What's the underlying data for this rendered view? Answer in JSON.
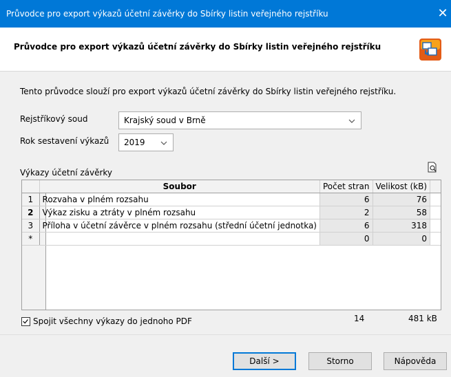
{
  "window": {
    "title": "Průvodce pro export výkazů účetní závěrky do Sbírky listin veřejného rejstříku",
    "close_glyph": "✕"
  },
  "header": {
    "title": "Průvodce pro export výkazů účetní závěrky do Sbírky listin veřejného rejstříku",
    "logo_icon": "export-wizard-icon",
    "logo_colors": [
      "#f7a21b",
      "#e35b16",
      "#2b6cb0"
    ]
  },
  "intro": "Tento průvodce slouží pro export výkazů účetní závěrky do Sbírky listin veřejného rejstříku.",
  "form": {
    "court_label": "Rejstříkový soud",
    "court_value": "Krajský soud v Brně",
    "year_label": "Rok sestavení výkazů",
    "year_value": "2019"
  },
  "reports": {
    "label": "Výkazy účetní závěrky",
    "preview_icon": "print-preview-icon",
    "columns": [
      "Soubor",
      "Počet stran",
      "Velikost (kB)"
    ],
    "rows": [
      {
        "num": "1",
        "file": "Rozvaha v plném rozsahu",
        "pages": "6",
        "size": "76"
      },
      {
        "num": "2",
        "file": "Výkaz zisku a ztráty v plném rozsahu",
        "pages": "2",
        "size": "58"
      },
      {
        "num": "3",
        "file": "Příloha v účetní závěrce v plném rozsahu (střední účetní jednotka)",
        "pages": "6",
        "size": "318"
      },
      {
        "num": "*",
        "file": "",
        "pages": "0",
        "size": "0"
      }
    ],
    "merge_label": "Spojit všechny výkazy do jednoho PDF",
    "merge_checked": true,
    "total_pages": "14",
    "total_size": "481 kB"
  },
  "buttons": {
    "next": "Další >",
    "cancel": "Storno",
    "help": "Nápověda"
  },
  "colors": {
    "titlebar": "#0078d7",
    "default_button_border": "#0078d7"
  }
}
